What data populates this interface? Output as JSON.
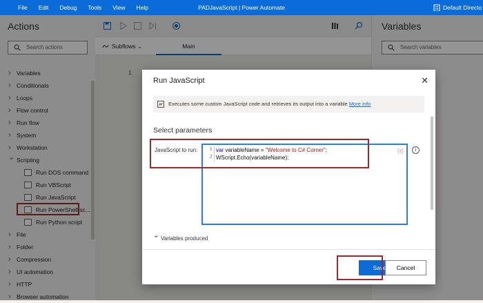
{
  "menu": [
    "File",
    "Edit",
    "Debug",
    "Tools",
    "View",
    "Help"
  ],
  "app_title": "PADJavaScript | Power Automate",
  "directory": "Default Directo",
  "actions_panel": {
    "title": "Actions",
    "search_placeholder": "Search actions",
    "categories_before": [
      "Variables",
      "Conditionals",
      "Loops",
      "Flow control",
      "Run flow",
      "System",
      "Workstation"
    ],
    "scripting": "Scripting",
    "scripting_items": [
      "Run DOS command",
      "Run VBScript",
      "Run JavaScript",
      "Run PowerShell sc...",
      "Run Python script"
    ],
    "categories_after": [
      "File",
      "Folder",
      "Compression",
      "UI automation",
      "HTTP",
      "Browser automation"
    ]
  },
  "designer": {
    "subflows_label": "Subflows",
    "main_tab": "Main",
    "line_number": "1"
  },
  "variables_panel": {
    "title": "Variables",
    "search_placeholder": "Search variables"
  },
  "dialog": {
    "title": "Run JavaScript",
    "info_text": "Executes some custom JavaScript code and retrieves its output into a variable",
    "info_link": "More info",
    "section_title": "Select parameters",
    "field_label": "JavaScript to run:",
    "code_line1_kw": "var",
    "code_line1_rest": " variableName = ",
    "code_line1_str": "\"Welcome to C# Corner\"",
    "code_line1_end": ";",
    "code_line2": "WScript.Echo(variableName);",
    "gutter1": "1",
    "gutter2": "2",
    "fx_label": "{x}",
    "variables_produced": "Variables produced",
    "save_label": "Save",
    "cancel_label": "Cancel"
  }
}
